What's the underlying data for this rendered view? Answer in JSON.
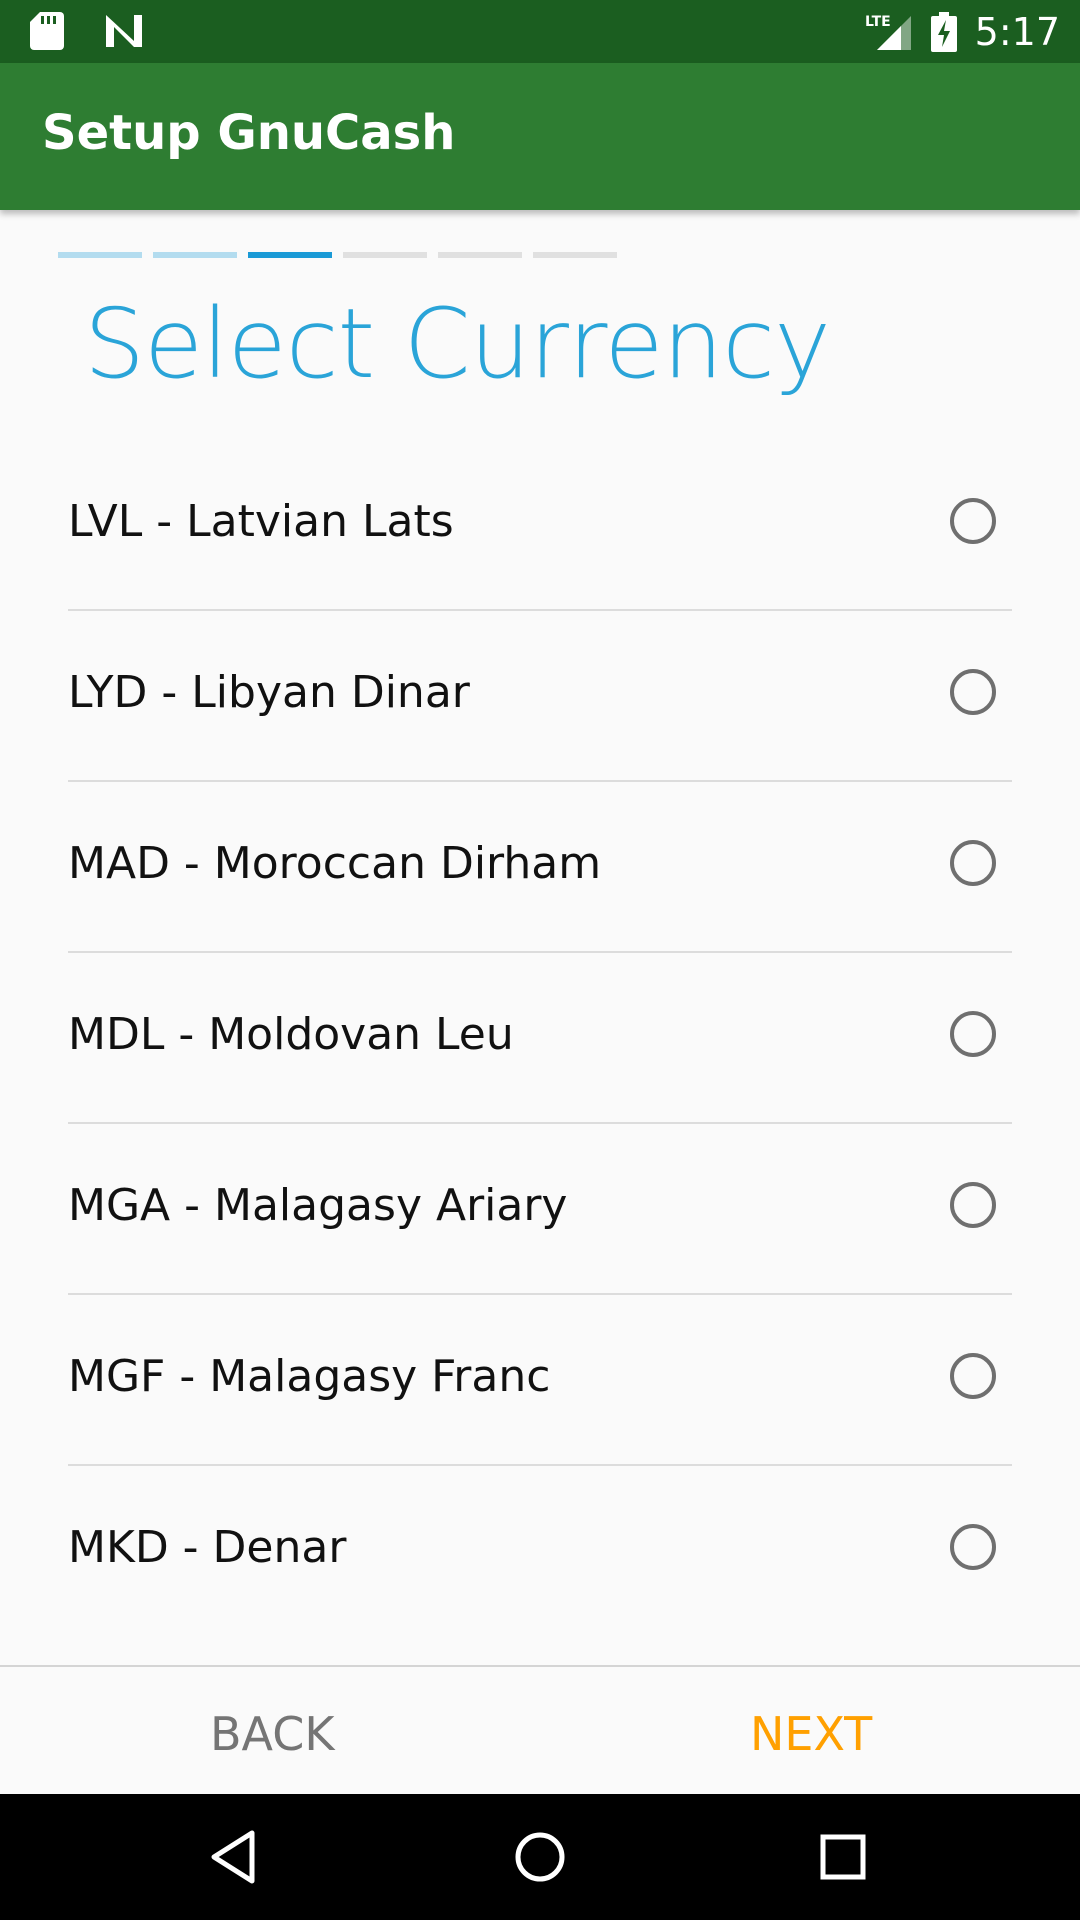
{
  "status_bar": {
    "time": "5:17",
    "network": "LTE",
    "icons": [
      "sd-card-icon",
      "n-notification-icon",
      "lte-signal-icon",
      "battery-charging-icon"
    ]
  },
  "app_bar": {
    "title": "Setup GnuCash"
  },
  "wizard": {
    "total_steps": 6,
    "current_step": 3,
    "heading": "Select Currency"
  },
  "currencies": [
    {
      "label": "LVL - Latvian Lats",
      "selected": false
    },
    {
      "label": "LYD - Libyan Dinar",
      "selected": false
    },
    {
      "label": "MAD - Moroccan Dirham",
      "selected": false
    },
    {
      "label": "MDL - Moldovan Leu",
      "selected": false
    },
    {
      "label": "MGA - Malagasy Ariary",
      "selected": false
    },
    {
      "label": "MGF - Malagasy Franc",
      "selected": false
    },
    {
      "label": "MKD - Denar",
      "selected": false
    }
  ],
  "buttons": {
    "back": "BACK",
    "next": "NEXT"
  },
  "colors": {
    "status_bar": "#1b5e20",
    "app_bar": "#2e7d32",
    "heading": "#2aa4d8",
    "next_button": "#ffa000",
    "back_button": "#757575"
  },
  "nav_bar": {
    "icons": [
      "back-icon",
      "home-icon",
      "recents-icon"
    ]
  }
}
